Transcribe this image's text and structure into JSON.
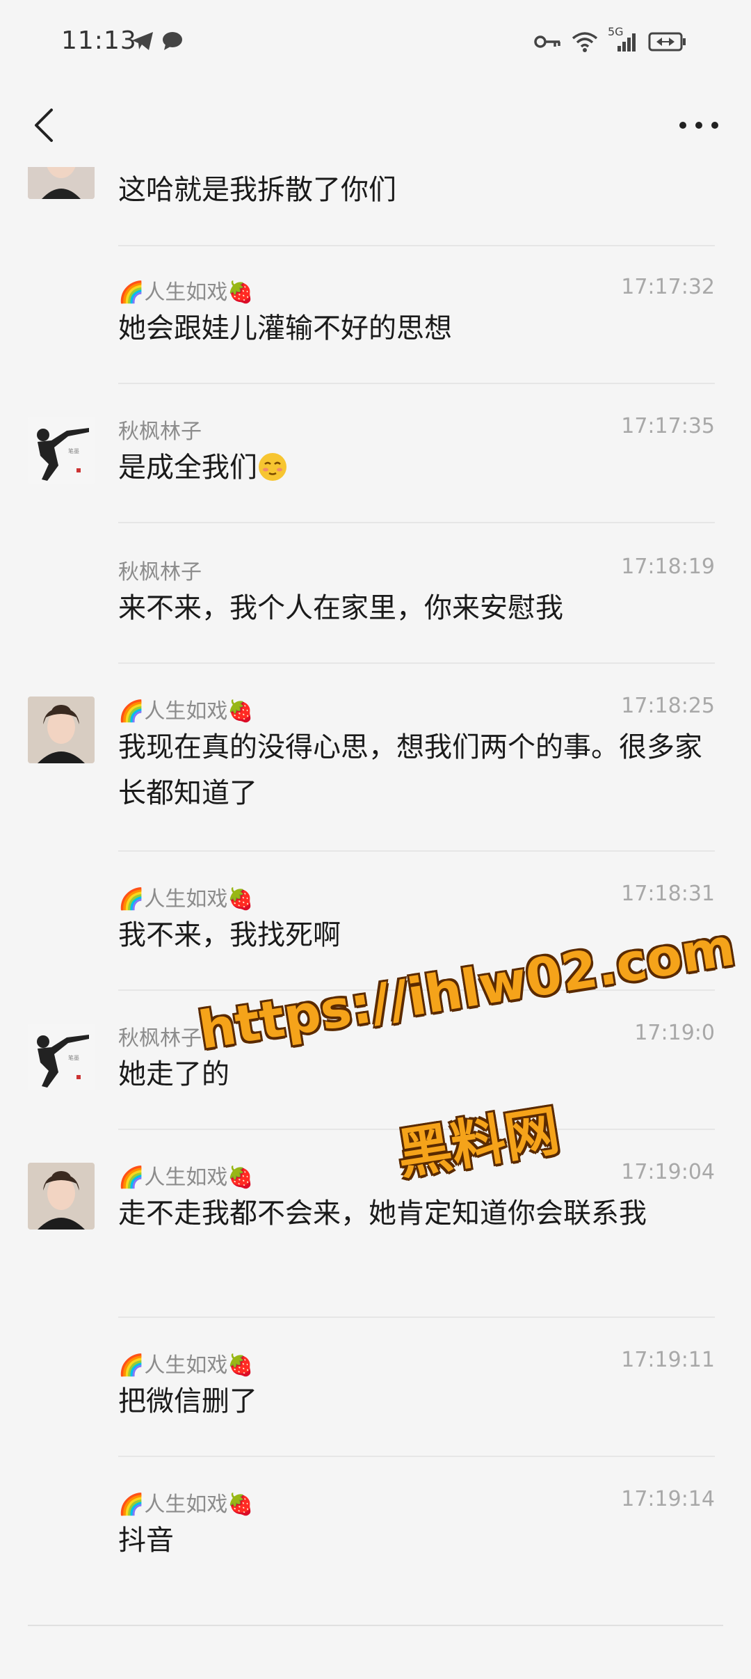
{
  "status": {
    "time": "11:13",
    "network": "5G"
  },
  "nav": {
    "back_icon": "chevron-left-icon",
    "more_icon": "more-dots-icon"
  },
  "messages": [
    {
      "sender": "",
      "time": "",
      "text": "这哈就是我拆散了你们",
      "avatar": "woman"
    },
    {
      "sender": "🌈人生如戏🍓",
      "time": "17:17:32",
      "text": "她会跟娃儿灌输不好的思想",
      "avatar": ""
    },
    {
      "sender": "秋枫林子",
      "time": "17:17:35",
      "text": "是成全我们",
      "emoji": "😌",
      "avatar": "man"
    },
    {
      "sender": "秋枫林子",
      "time": "17:18:19",
      "text": "来不来，我个人在家里，你来安慰我",
      "avatar": ""
    },
    {
      "sender": "🌈人生如戏🍓",
      "time": "17:18:25",
      "text": "我现在真的没得心思，想我们两个的事。很多家长都知道了",
      "avatar": "woman"
    },
    {
      "sender": "🌈人生如戏🍓",
      "time": "17:18:31",
      "text": "我不来，我找死啊",
      "avatar": ""
    },
    {
      "sender": "秋枫林子",
      "time": "17:19:0",
      "text": "她走了的",
      "avatar": "man"
    },
    {
      "sender": "🌈人生如戏🍓",
      "time": "17:19:04",
      "text": "走不走我都不会来，她肯定知道你会联系我",
      "avatar": "woman"
    },
    {
      "sender": "🌈人生如戏🍓",
      "time": "17:19:11",
      "text": "把微信删了",
      "avatar": ""
    },
    {
      "sender": "🌈人生如戏🍓",
      "time": "17:19:14",
      "text": "抖音",
      "avatar": ""
    }
  ],
  "watermark": {
    "url": "https://ihlw02.com",
    "name": "黑料网"
  }
}
